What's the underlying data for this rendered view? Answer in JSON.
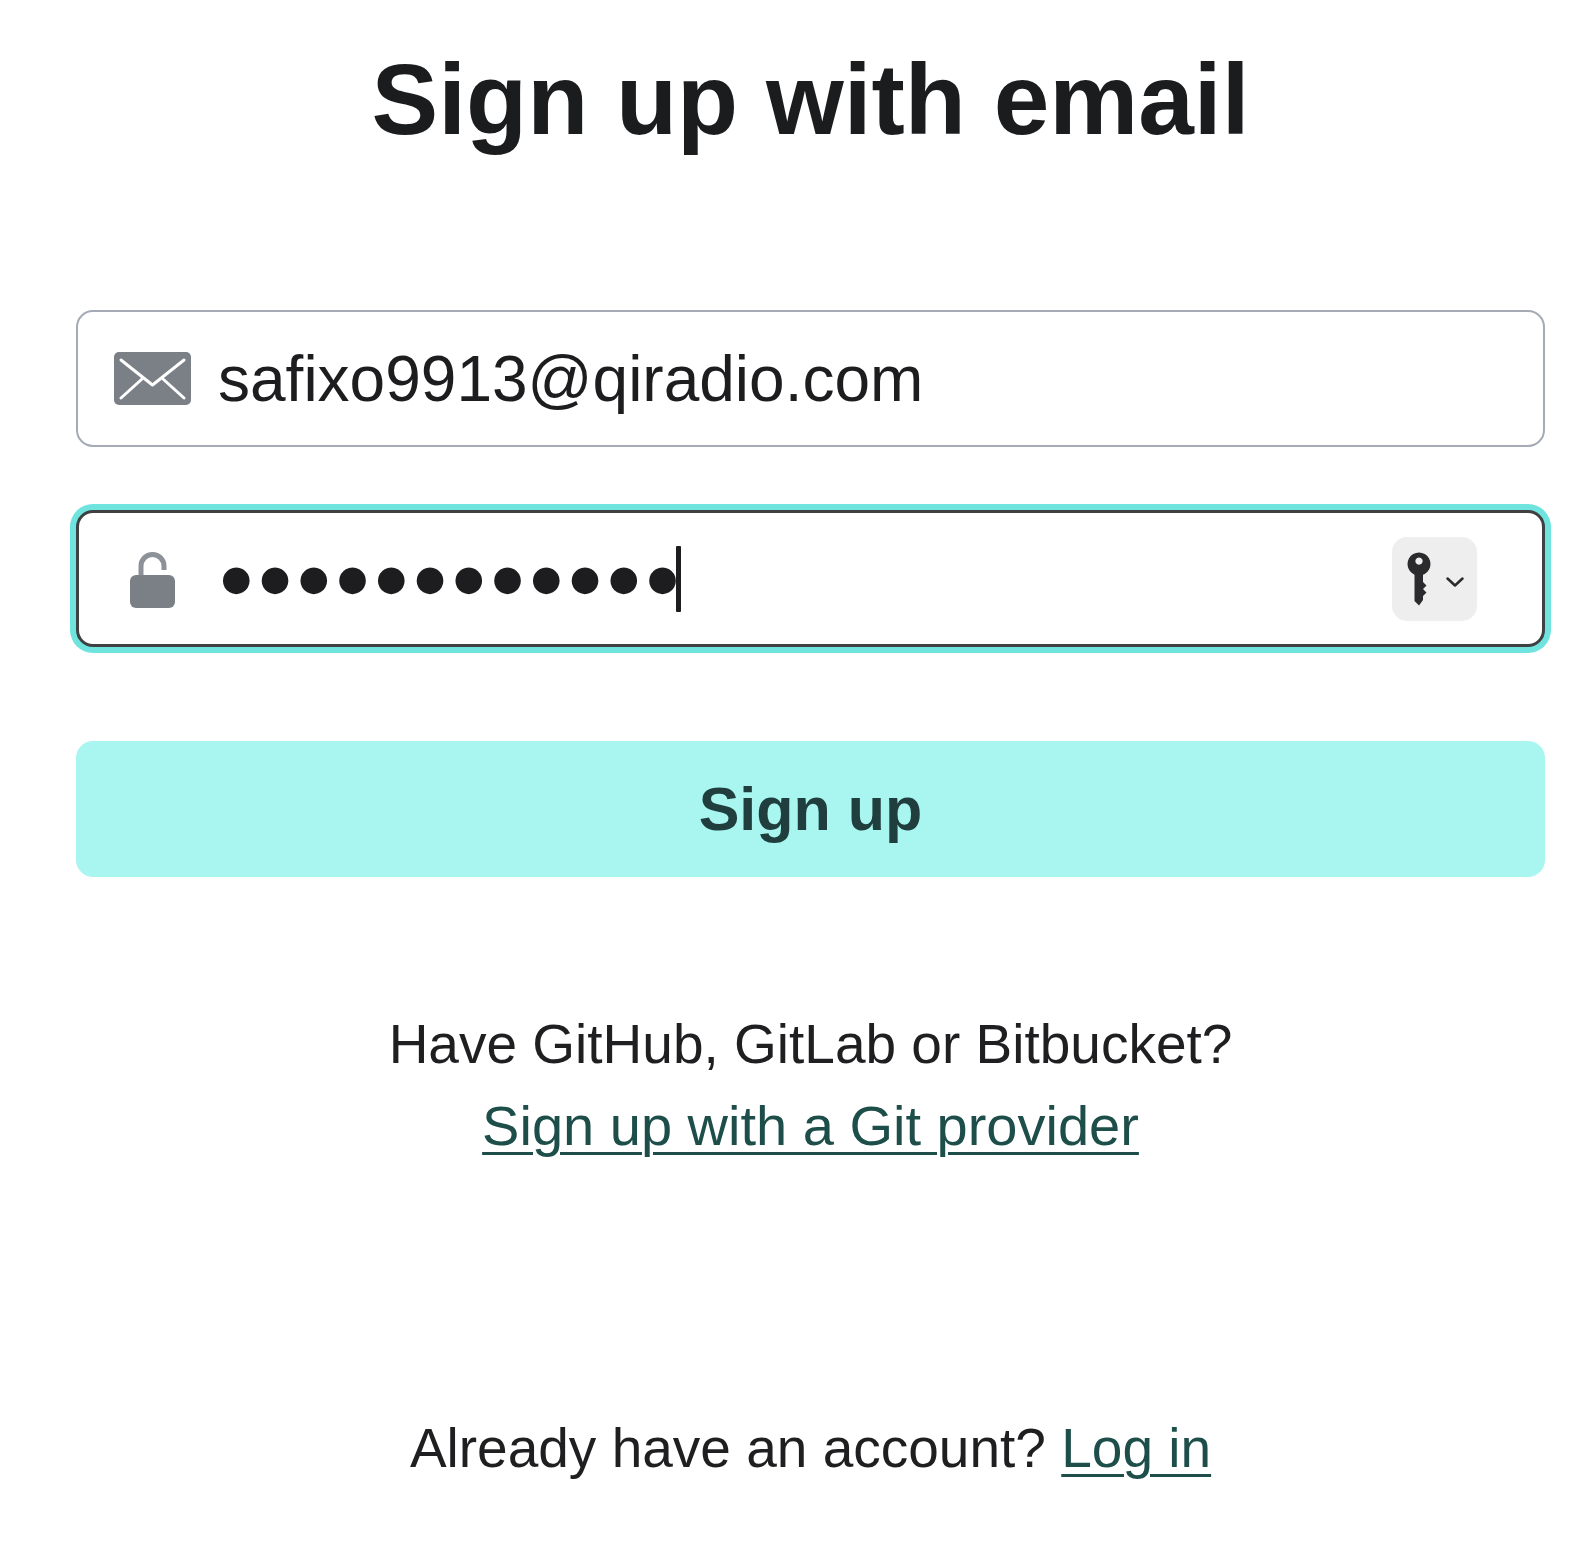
{
  "title": "Sign up with email",
  "fields": [
    {
      "kind": "email",
      "value": "safixo9913@qiradio.com",
      "focused": false
    },
    {
      "kind": "password",
      "value": "●●●●●●●●●●●●",
      "focused": true
    }
  ],
  "sign_up_button": {
    "label": "Sign up"
  },
  "git_signup": {
    "text": "Have GitHub, GitLab or Bitbucket?",
    "link": "Sign up with a Git provider"
  },
  "login": {
    "text": "Already have an account?",
    "link": "Log in"
  }
}
